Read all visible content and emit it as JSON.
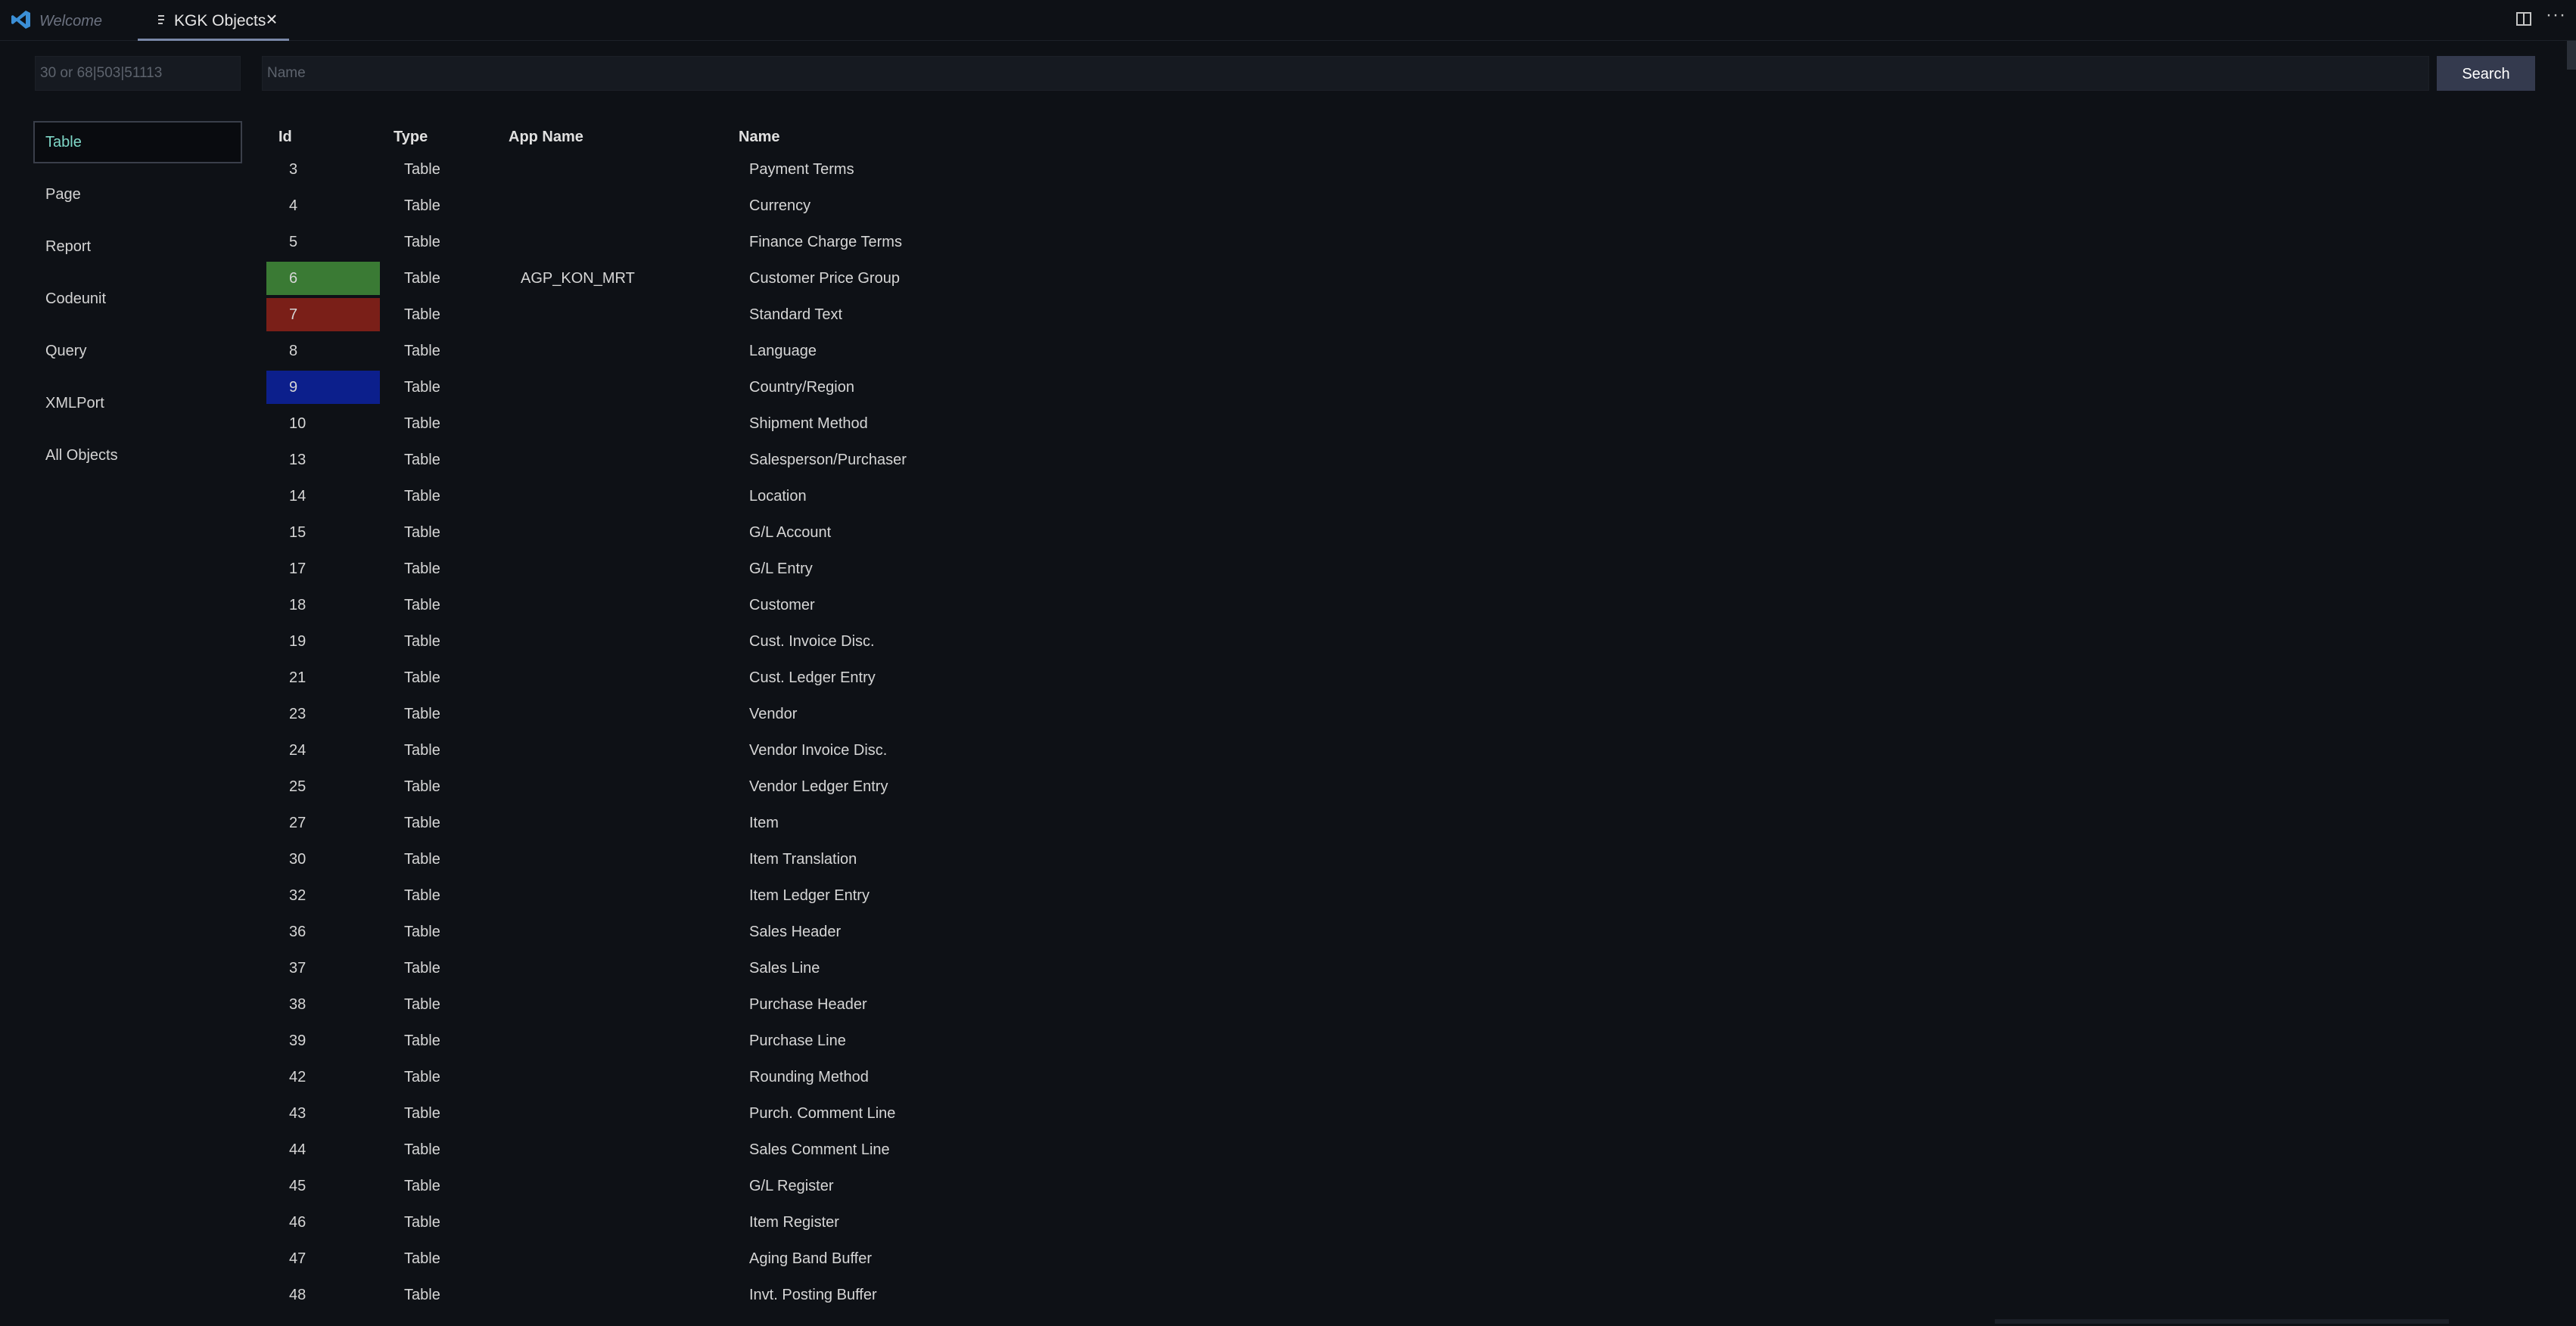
{
  "tabs": [
    {
      "label": "Welcome"
    },
    {
      "label": "KGK Objects"
    }
  ],
  "search": {
    "id_placeholder": "30 or 68|503|51113",
    "name_placeholder": "Name",
    "button_label": "Search"
  },
  "sidebar": {
    "items": [
      {
        "label": "Table",
        "active": true
      },
      {
        "label": "Page"
      },
      {
        "label": "Report"
      },
      {
        "label": "Codeunit"
      },
      {
        "label": "Query"
      },
      {
        "label": "XMLPort"
      },
      {
        "label": "All Objects"
      }
    ]
  },
  "table": {
    "columns": [
      "Id",
      "Type",
      "App Name",
      "Name"
    ],
    "highlight_colors": {
      "green": "#3a7a34",
      "red": "#7a1f18",
      "blue": "#0c1f8c"
    },
    "rows": [
      {
        "id": "3",
        "type": "Table",
        "app": "",
        "name": "Payment Terms"
      },
      {
        "id": "4",
        "type": "Table",
        "app": "",
        "name": "Currency"
      },
      {
        "id": "5",
        "type": "Table",
        "app": "",
        "name": "Finance Charge Terms"
      },
      {
        "id": "6",
        "type": "Table",
        "app": "AGP_KON_MRT",
        "name": "Customer Price Group",
        "highlight": "green"
      },
      {
        "id": "7",
        "type": "Table",
        "app": "",
        "name": "Standard Text",
        "highlight": "red"
      },
      {
        "id": "8",
        "type": "Table",
        "app": "",
        "name": "Language"
      },
      {
        "id": "9",
        "type": "Table",
        "app": "",
        "name": "Country/Region",
        "highlight": "blue"
      },
      {
        "id": "10",
        "type": "Table",
        "app": "",
        "name": "Shipment Method"
      },
      {
        "id": "13",
        "type": "Table",
        "app": "",
        "name": "Salesperson/Purchaser"
      },
      {
        "id": "14",
        "type": "Table",
        "app": "",
        "name": "Location"
      },
      {
        "id": "15",
        "type": "Table",
        "app": "",
        "name": "G/L Account"
      },
      {
        "id": "17",
        "type": "Table",
        "app": "",
        "name": "G/L Entry"
      },
      {
        "id": "18",
        "type": "Table",
        "app": "",
        "name": "Customer"
      },
      {
        "id": "19",
        "type": "Table",
        "app": "",
        "name": "Cust. Invoice Disc."
      },
      {
        "id": "21",
        "type": "Table",
        "app": "",
        "name": "Cust. Ledger Entry"
      },
      {
        "id": "23",
        "type": "Table",
        "app": "",
        "name": "Vendor"
      },
      {
        "id": "24",
        "type": "Table",
        "app": "",
        "name": "Vendor Invoice Disc."
      },
      {
        "id": "25",
        "type": "Table",
        "app": "",
        "name": "Vendor Ledger Entry"
      },
      {
        "id": "27",
        "type": "Table",
        "app": "",
        "name": "Item"
      },
      {
        "id": "30",
        "type": "Table",
        "app": "",
        "name": "Item Translation"
      },
      {
        "id": "32",
        "type": "Table",
        "app": "",
        "name": "Item Ledger Entry"
      },
      {
        "id": "36",
        "type": "Table",
        "app": "",
        "name": "Sales Header"
      },
      {
        "id": "37",
        "type": "Table",
        "app": "",
        "name": "Sales Line"
      },
      {
        "id": "38",
        "type": "Table",
        "app": "",
        "name": "Purchase Header"
      },
      {
        "id": "39",
        "type": "Table",
        "app": "",
        "name": "Purchase Line"
      },
      {
        "id": "42",
        "type": "Table",
        "app": "",
        "name": "Rounding Method"
      },
      {
        "id": "43",
        "type": "Table",
        "app": "",
        "name": "Purch. Comment Line"
      },
      {
        "id": "44",
        "type": "Table",
        "app": "",
        "name": "Sales Comment Line"
      },
      {
        "id": "45",
        "type": "Table",
        "app": "",
        "name": "G/L Register"
      },
      {
        "id": "46",
        "type": "Table",
        "app": "",
        "name": "Item Register"
      },
      {
        "id": "47",
        "type": "Table",
        "app": "",
        "name": "Aging Band Buffer"
      },
      {
        "id": "48",
        "type": "Table",
        "app": "",
        "name": "Invt. Posting Buffer"
      }
    ]
  }
}
